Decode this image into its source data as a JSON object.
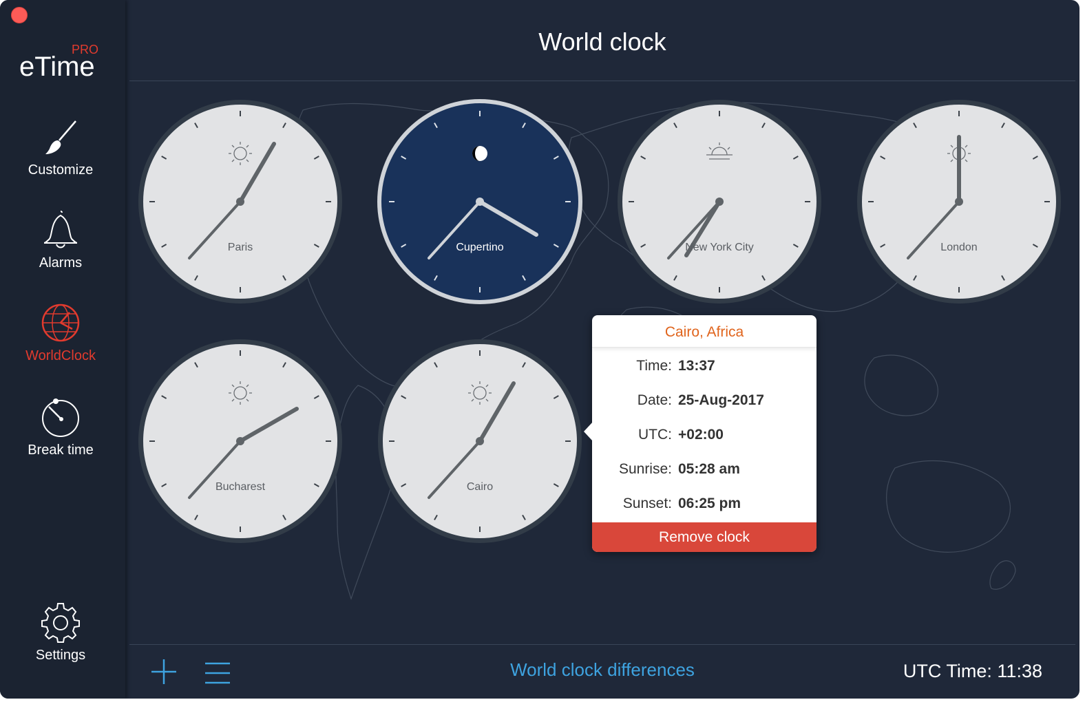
{
  "window": {
    "close_color": "#fc5b57"
  },
  "app": {
    "logo_text": "eTime",
    "logo_badge": "PRO",
    "accent": "#e23b2e"
  },
  "sidebar": {
    "items": [
      {
        "label": "Customize",
        "icon": "brush-icon"
      },
      {
        "label": "Alarms",
        "icon": "bell-icon"
      },
      {
        "label": "WorldClock",
        "icon": "globe-clock-icon",
        "active": true
      },
      {
        "label": "Break time",
        "icon": "stopwatch-icon"
      }
    ],
    "settings": {
      "label": "Settings",
      "icon": "gear-icon"
    }
  },
  "header": {
    "title": "World clock"
  },
  "clocks": [
    {
      "city": "Paris",
      "time": "13:38",
      "indicator": "sun-icon",
      "theme": "day"
    },
    {
      "city": "Cupertino",
      "time": "04:38",
      "indicator": "moon-icon",
      "theme": "night"
    },
    {
      "city": "New York City",
      "time": "07:38",
      "indicator": "sunrise-icon",
      "theme": "day"
    },
    {
      "city": "London",
      "time": "12:38",
      "indicator": "sun-icon",
      "theme": "day"
    },
    {
      "city": "Bucharest",
      "time": "14:38",
      "indicator": "sun-icon",
      "theme": "day"
    },
    {
      "city": "Cairo",
      "time": "13:38",
      "indicator": "sun-icon",
      "theme": "day"
    }
  ],
  "popover": {
    "title": "Cairo, Africa",
    "rows": [
      {
        "key": "Time:",
        "value": "13:37"
      },
      {
        "key": "Date:",
        "value": "25-Aug-2017"
      },
      {
        "key": "UTC:",
        "value": "+02:00"
      },
      {
        "key": "Sunrise:",
        "value": "05:28 am"
      },
      {
        "key": "Sunset:",
        "value": "06:25 pm"
      }
    ],
    "remove_label": "Remove clock",
    "title_color": "#e0641c",
    "remove_color": "#d9473a"
  },
  "footer": {
    "add_icon": "plus-icon",
    "list_icon": "list-icon",
    "differences_label": "World clock differences",
    "utc_label": "UTC Time: 11:38"
  }
}
